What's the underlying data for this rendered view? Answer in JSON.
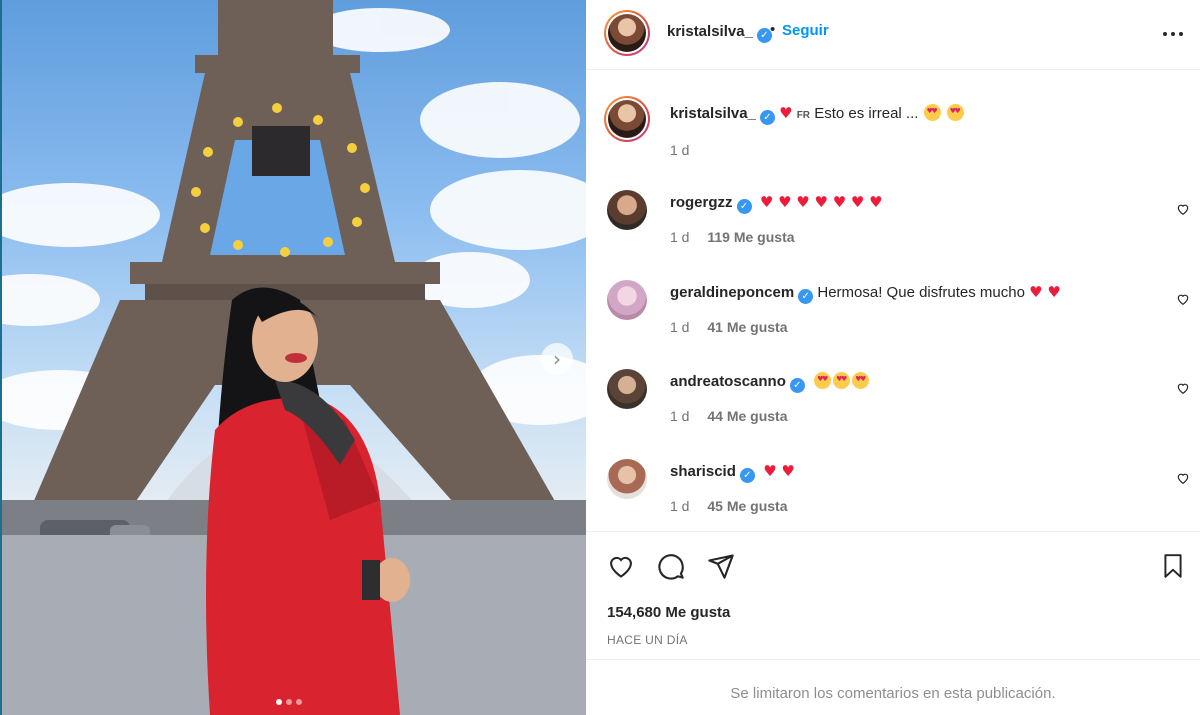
{
  "photo": {
    "alt": "",
    "slides_total": 3,
    "active_slide": 1
  },
  "header": {
    "username": "kristalsilva_",
    "separator": "•",
    "follow_label": "Seguir",
    "more_label": "•••"
  },
  "caption": {
    "username": "kristalsilva_",
    "lang_tag": "FR",
    "text": "Esto es irreal ...",
    "time": "1 d"
  },
  "comments": [
    {
      "username": "rogergzz",
      "text": "",
      "hearts": 7,
      "emojis": 0,
      "time": "1 d",
      "likes": "119 Me gusta"
    },
    {
      "username": "geraldineponcem",
      "text": "Hermosa! Que disfrutes mucho",
      "hearts": 2,
      "emojis": 0,
      "time": "1 d",
      "likes": "41 Me gusta"
    },
    {
      "username": "andreatoscanno",
      "text": "",
      "hearts": 0,
      "emojis": 3,
      "time": "1 d",
      "likes": "44 Me gusta"
    },
    {
      "username": "shariscid",
      "text": "",
      "hearts": 2,
      "emojis": 0,
      "time": "1 d",
      "likes": "45 Me gusta"
    }
  ],
  "footer": {
    "likes_total": "154,680 Me gusta",
    "time_ago": "HACE UN DÍA",
    "comments_limited": "Se limitaron los comentarios en esta publicación."
  },
  "colors": {
    "follow_blue": "#0095f6",
    "verified_blue": "#3897f0",
    "heart_red": "#ed1c3a",
    "coat_red": "#d9232e"
  },
  "icons": [
    "verified-icon",
    "more-icon",
    "heart-icon",
    "comment-icon",
    "share-icon",
    "bookmark-icon",
    "chevron-right-icon"
  ]
}
